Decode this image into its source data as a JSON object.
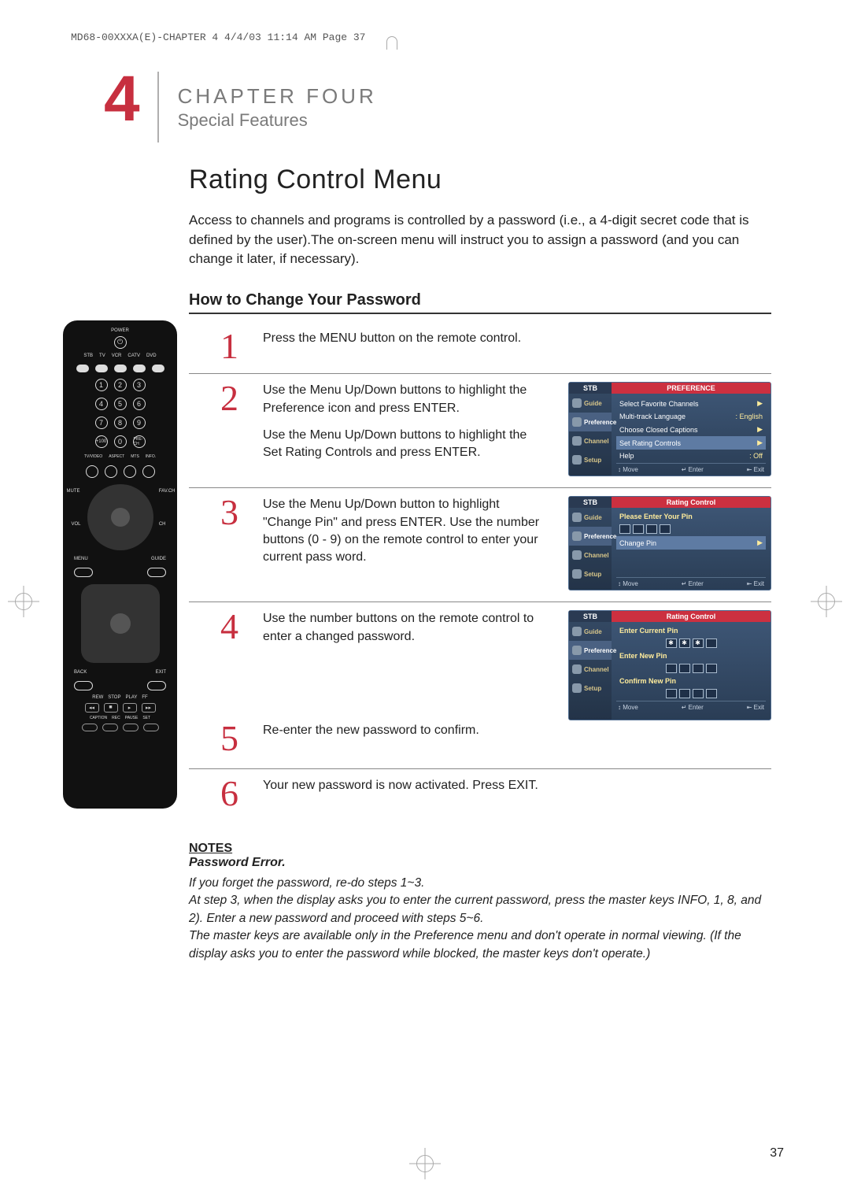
{
  "print_header": "MD68-00XXXA(E)-CHAPTER 4  4/4/03  11:14 AM  Page 37",
  "chapter": {
    "number": "4",
    "label": "CHAPTER FOUR",
    "subtitle": "Special Features"
  },
  "section_title": "Rating Control Menu",
  "intro": "Access to channels and programs is controlled by a password (i.e., a 4-digit secret code that is defined by the user).The on-screen menu will instruct you to assign a password (and you can change it later, if necessary).",
  "sub_title": "How to Change Your Password",
  "remote": {
    "power": "POWER",
    "device_row": [
      "STB",
      "TV",
      "VCR",
      "CATV",
      "DVD"
    ],
    "numpad": [
      "1",
      "2",
      "3",
      "4",
      "5",
      "6",
      "7",
      "8",
      "9",
      "+100",
      "0",
      "PRE-CH"
    ],
    "mode_row": [
      "TV/VIDEO",
      "ASPECT",
      "MTS",
      "INFO."
    ],
    "mute": "MUTE",
    "vol": "VOL",
    "ch": "CH",
    "favch": "FAV.CH",
    "menu": "MENU",
    "guide": "GUIDE",
    "back": "BACK",
    "exit": "EXIT",
    "transport": [
      "REW",
      "STOP",
      "PLAY",
      "FF"
    ],
    "bottom_row": [
      "CAPTION",
      "REC",
      "PAUSE",
      "SET"
    ]
  },
  "steps": [
    {
      "n": "1",
      "text_a": "Press the MENU button on the remote control."
    },
    {
      "n": "2",
      "text_a": "Use the Menu Up/Down buttons to highlight the Preference icon and press ENTER.",
      "text_b": "Use the Menu Up/Down buttons to highlight the Set Rating Controls and press ENTER."
    },
    {
      "n": "3",
      "text_a": "Use the Menu Up/Down button to highlight \"Change Pin\" and press ENTER. Use the number buttons (0 - 9) on the remote control to enter your current pass word."
    },
    {
      "n": "4",
      "text_a": "Use the number buttons on the remote control to enter a changed password."
    },
    {
      "n": "5",
      "text_a": "Re-enter the new password to confirm."
    },
    {
      "n": "6",
      "text_a": "Your new password is now activated. Press EXIT."
    }
  ],
  "osd_common": {
    "stb": "STB",
    "tabs": [
      "Guide",
      "Preference",
      "Channel",
      "Setup"
    ],
    "footer_move": "Move",
    "footer_enter": "Enter",
    "footer_exit": "Exit"
  },
  "osd1": {
    "title": "PREFERENCE",
    "items": [
      {
        "l": "Select Favorite Channels",
        "r": "▶"
      },
      {
        "l": "Multi-track Language",
        "r": ": English"
      },
      {
        "l": "Choose Closed Captions",
        "r": "▶"
      },
      {
        "l": "Set Rating Controls",
        "r": "▶",
        "sel": true
      },
      {
        "l": "Help",
        "r": ": Off"
      }
    ]
  },
  "osd2": {
    "title": "Rating Control",
    "enter_pin_label": "Please Enter Your Pin",
    "change_pin_label": "Change Pin"
  },
  "osd3": {
    "title": "Rating Control",
    "enter_current": "Enter Current Pin",
    "enter_new": "Enter New Pin",
    "confirm_new": "Confirm New Pin"
  },
  "notes": {
    "label": "NOTES",
    "subtitle": "Password Error.",
    "body": "If you forget the password, re-do steps 1~3.\nAt step 3, when the display asks you to enter the current password, press the master keys INFO, 1, 8, and 2). Enter a new password and proceed with steps 5~6.\nThe master keys are available only in the Preference menu and don't operate in normal viewing. (If the display asks you to enter the password while blocked, the master keys don't operate.)"
  },
  "page_number": "37"
}
